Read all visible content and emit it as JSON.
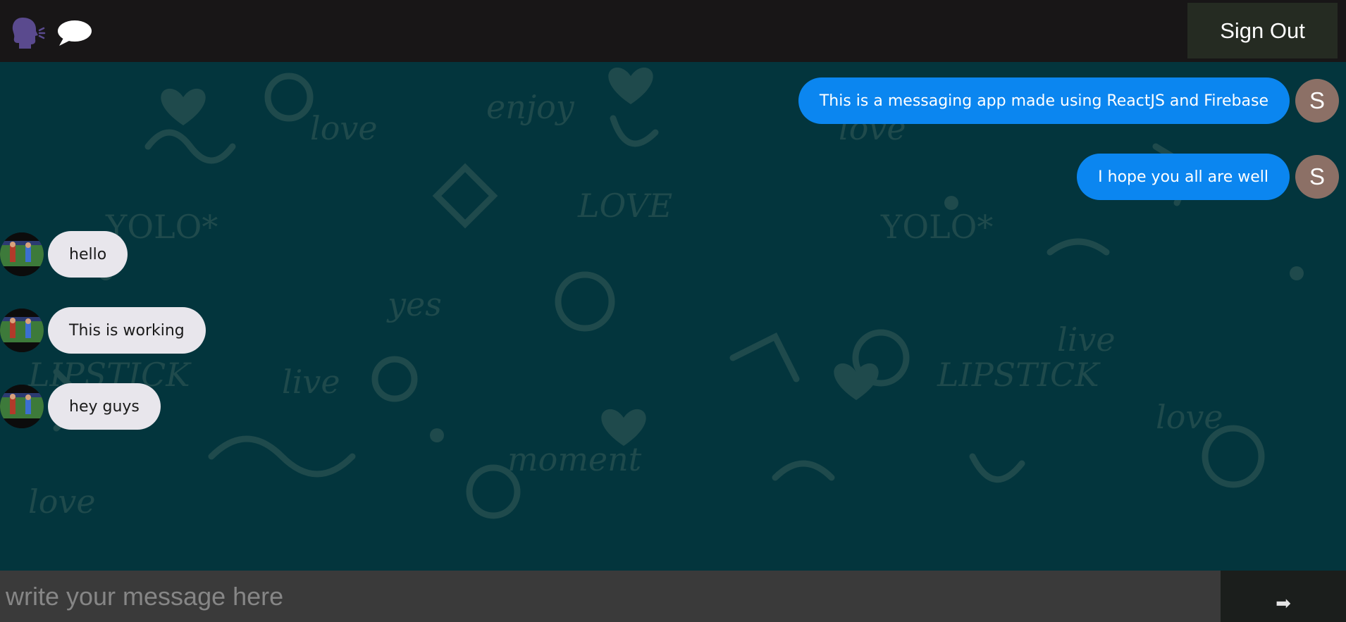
{
  "header": {
    "logo_icons": [
      "speaking-head-icon",
      "speech-bubble-icon"
    ],
    "signout_label": "Sign Out"
  },
  "messages": [
    {
      "direction": "sent",
      "text": "This is a messaging app made using ReactJS and Firebase",
      "avatar_letter": "S"
    },
    {
      "direction": "sent",
      "text": "I hope you all are well",
      "avatar_letter": "S"
    },
    {
      "direction": "received",
      "text": "hello",
      "avatar": "user-photo"
    },
    {
      "direction": "received",
      "text": "This is working",
      "avatar": "user-photo"
    },
    {
      "direction": "received",
      "text": "hey guys",
      "avatar": "user-photo"
    }
  ],
  "composer": {
    "placeholder": "write your message here",
    "send_icon": "➡"
  },
  "colors": {
    "header_bg": "#181617",
    "chat_bg": "#03353d",
    "sent_bubble": "#0b86f0",
    "received_bubble": "#e8e6ec",
    "avatar_bg": "#8c7066",
    "signout_bg": "#252b22"
  }
}
